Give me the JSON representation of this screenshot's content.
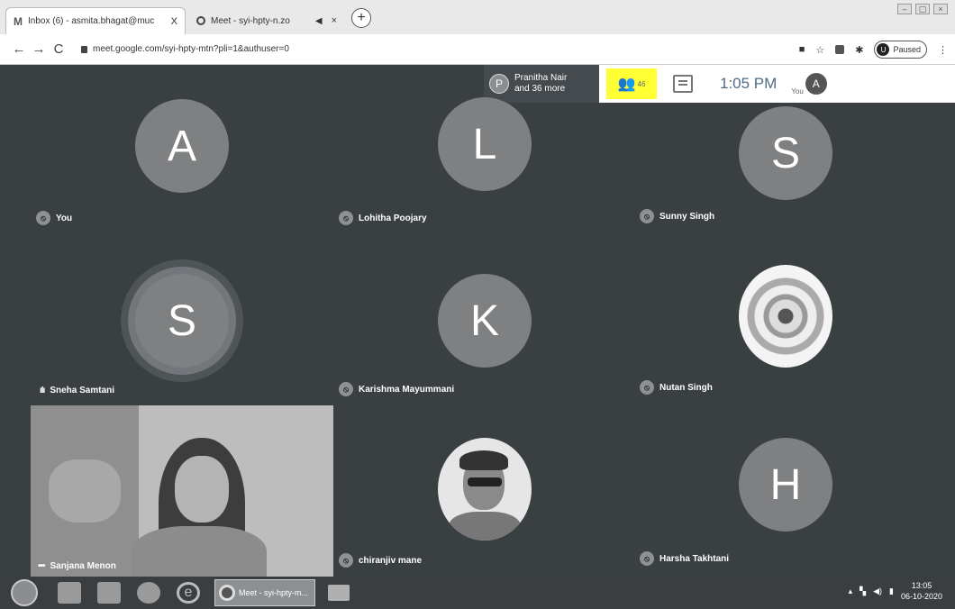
{
  "browser": {
    "tabs": [
      {
        "title": "Inbox (6) - asmita.bhagat@muc",
        "close": "X"
      },
      {
        "title": "Meet - syi-hpty-n.zo",
        "close": "×"
      }
    ],
    "new_tab": "+",
    "url": "meet.google.com/syi-hpty-mtn?pli=1&authuser=0",
    "profile_initial": "U",
    "profile_status": "Paused"
  },
  "meet": {
    "presenter": {
      "initial": "P",
      "name_line1": "Pranitha Nair",
      "name_line2": "and 36 more"
    },
    "participant_count": "46",
    "time": "1:05 PM",
    "you_label": "You",
    "self_initial": "A",
    "participants": [
      {
        "initial": "A",
        "name": "You"
      },
      {
        "initial": "L",
        "name": "Lohitha Poojary"
      },
      {
        "initial": "S",
        "name": "Sunny Singh"
      },
      {
        "initial": "S",
        "name": "Sneha Samtani"
      },
      {
        "initial": "K",
        "name": "Karishma Mayummani"
      },
      {
        "initial": "",
        "name": "Nutan Singh"
      },
      {
        "initial": "",
        "name": "Sanjana Menon"
      },
      {
        "initial": "",
        "name": "chiranjiv mane"
      },
      {
        "initial": "H",
        "name": "Harsha Takhtani"
      }
    ]
  },
  "taskbar": {
    "chrome_label": "Meet - syi-hpty-m...",
    "clock_time": "13:05",
    "clock_date": "06-10-2020"
  },
  "colors": {
    "meet_bg": "#3a3f42",
    "avatar_bg": "#7e8082",
    "people_highlight": "#ffff33",
    "time_color": "#4d6c87"
  }
}
